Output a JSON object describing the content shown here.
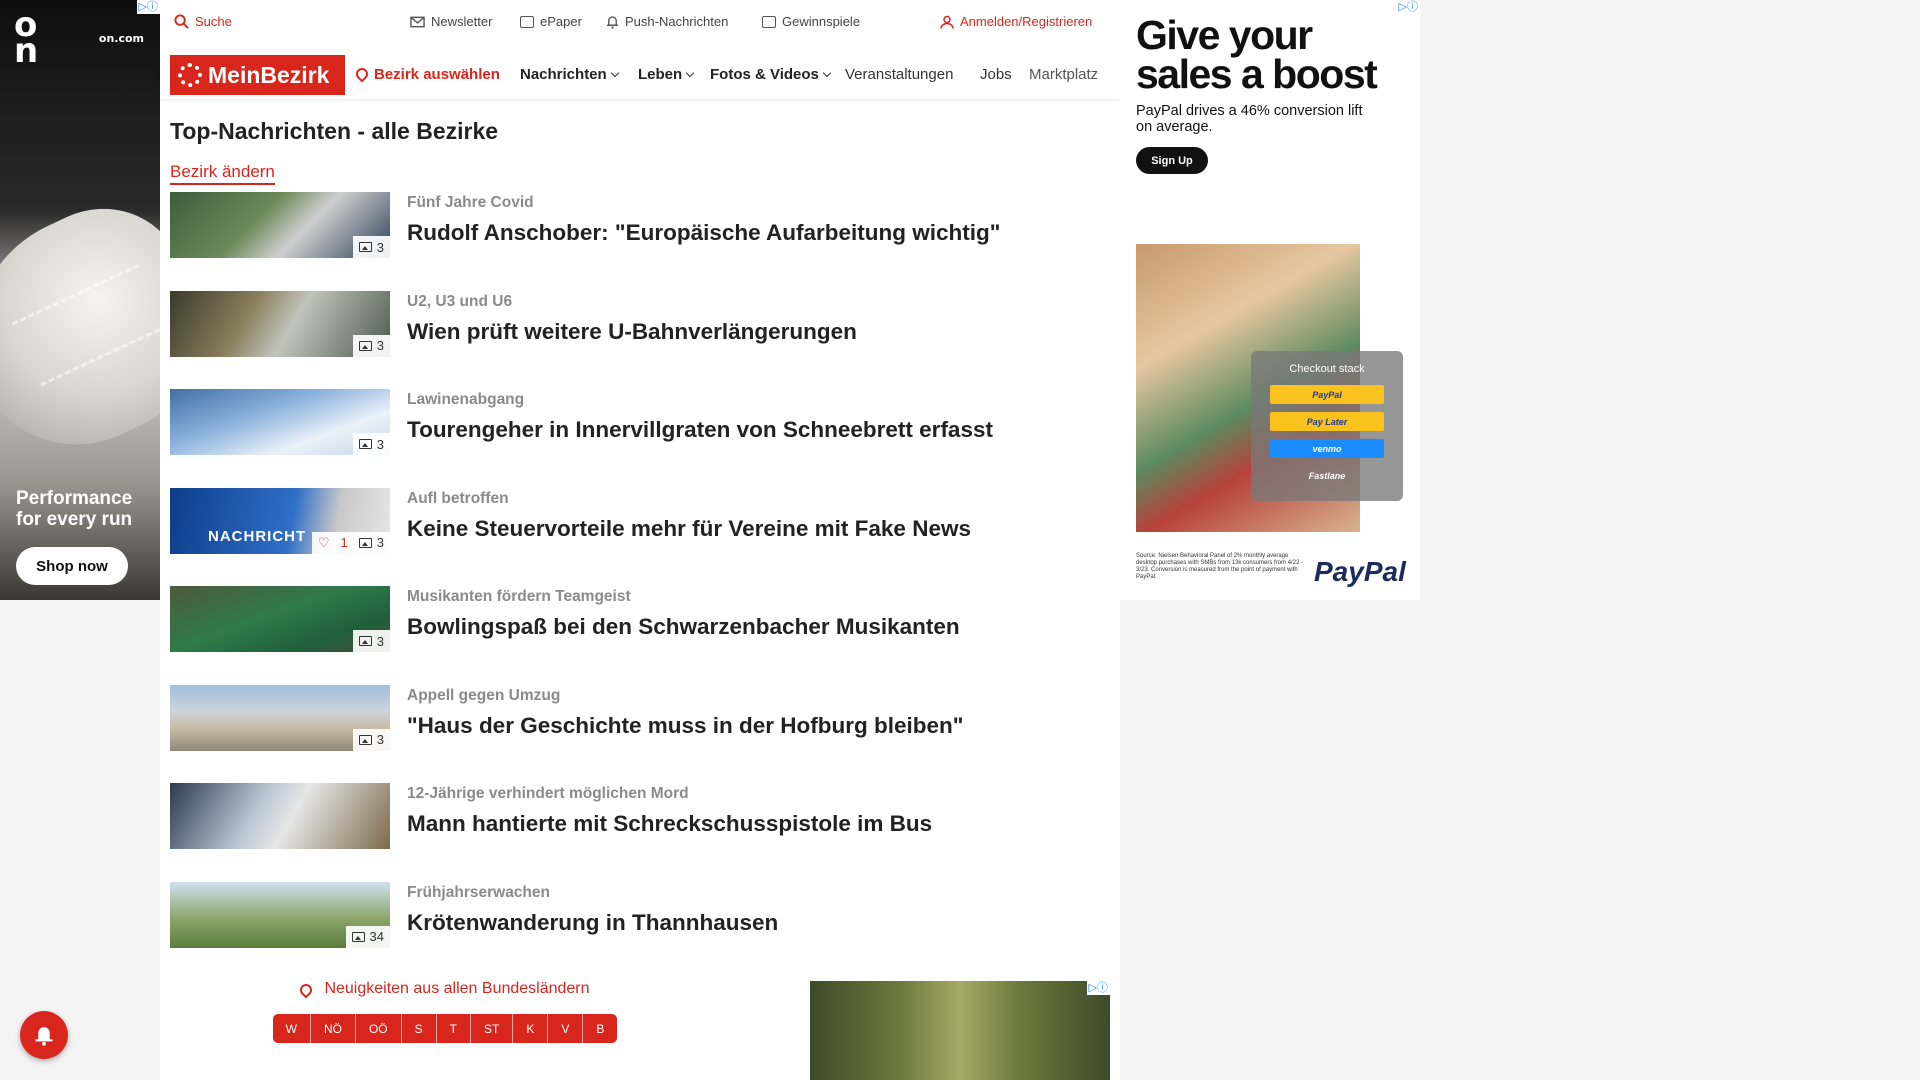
{
  "topbar": {
    "search": "Suche",
    "newsletter": "Newsletter",
    "epaper": "ePaper",
    "push": "Push-Nachrichten",
    "games": "Gewinnspiele",
    "login": "Anmelden/Registrieren"
  },
  "nav": {
    "logo": "MeinBezirk",
    "bezirk": "Bezirk auswählen",
    "nachrichten": "Nachrichten",
    "leben": "Leben",
    "fotos": "Fotos & Videos",
    "veranstaltungen": "Veranstaltungen",
    "jobs": "Jobs",
    "marktplatz": "Marktplatz"
  },
  "page": {
    "title": "Top-Nachrichten - alle Bezirke",
    "change_district": "Bezirk ändern"
  },
  "articles": [
    {
      "kicker": "Fünf Jahre Covid",
      "headline": "Rudolf Anschober: \"Europäische Aufarbeitung wichtig\"",
      "images": "3"
    },
    {
      "kicker": "U2, U3 und U6",
      "headline": "Wien prüft weitere U-Bahnverlängerungen",
      "images": "3"
    },
    {
      "kicker": "Lawinenabgang",
      "headline": "Tourengeher in Innervillgraten von Schneebrett erfasst",
      "images": "3"
    },
    {
      "kicker": "Aufl betroffen",
      "headline": "Keine Steuervorteile mehr für Vereine mit Fake News",
      "images": "3",
      "likes": "1",
      "thumb_text": "NACHRICHT"
    },
    {
      "kicker": "Musikanten fördern Teamgeist",
      "headline": "Bowlingspaß bei den Schwarzenbacher Musikanten",
      "images": "3"
    },
    {
      "kicker": "Appell gegen Umzug",
      "headline": "\"Haus der Geschichte muss in der Hofburg bleiben\"",
      "images": "3"
    },
    {
      "kicker": "12-Jährige verhindert möglichen Mord",
      "headline": "Mann hantierte mit Schreckschusspistole im Bus",
      "images": ""
    },
    {
      "kicker": "Frühjahrserwachen",
      "headline": "Krötenwanderung in Thannhausen",
      "images": "34"
    }
  ],
  "regions": {
    "title": "Neuigkeiten aus allen Bundesländern",
    "items": [
      "W",
      "NÖ",
      "OÖ",
      "S",
      "T",
      "ST",
      "K",
      "V",
      "B"
    ]
  },
  "left_ad": {
    "brand": "on.com",
    "tagline": "Performance for every run",
    "cta": "Shop now"
  },
  "right_ad": {
    "headline": "Give your sales a boost",
    "sub": "PayPal drives a 46% conversion lift on average.",
    "cta": "Sign Up",
    "card_title": "Checkout stack",
    "pay_options": [
      "PayPal",
      "Pay Later",
      "venmo",
      "Fastlane"
    ],
    "source": "Source: Nielsen Behavioral Panel of 2% monthly average desktop purchases with SMBs from 13k consumers from 4/22 - 3/23. Conversion is measured from the point of payment with PayPal.",
    "logo": "PayPal"
  },
  "colors": {
    "brand_red": "#d9261c",
    "kicker_gray": "#8a8a8a"
  }
}
